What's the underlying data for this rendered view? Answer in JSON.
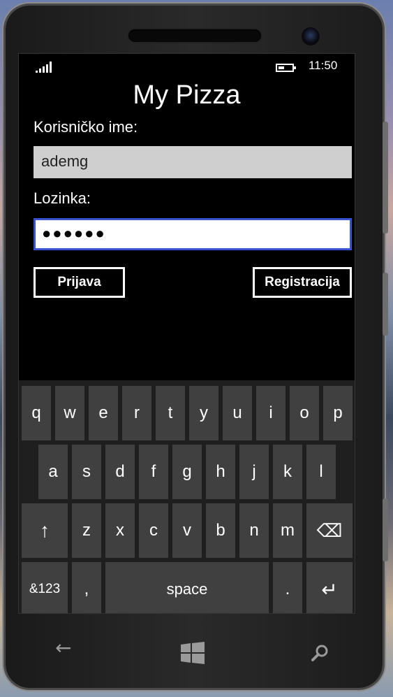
{
  "status_bar": {
    "time": "11:50",
    "icons": [
      "signal-icon",
      "battery-charging-icon"
    ]
  },
  "app": {
    "title": "My Pizza"
  },
  "form": {
    "username_label": "Korisničko ime:",
    "username_value": "ademg",
    "password_label": "Lozinka:",
    "password_value": "●●●●●●",
    "login_button": "Prijava",
    "register_button": "Registracija"
  },
  "keyboard": {
    "row1": [
      "q",
      "w",
      "e",
      "r",
      "t",
      "y",
      "u",
      "i",
      "o",
      "p"
    ],
    "row2": [
      "a",
      "s",
      "d",
      "f",
      "g",
      "h",
      "j",
      "k",
      "l"
    ],
    "row3_letters": [
      "z",
      "x",
      "c",
      "v",
      "b",
      "n",
      "m"
    ],
    "shift_icon": "↑",
    "backspace_icon": "⌫",
    "symbols_label": "&123",
    "comma_label": ",",
    "space_label": "space",
    "period_label": ".",
    "enter_icon": "↵"
  },
  "nav_bar": {
    "back_icon": "←",
    "search_icon": "search"
  },
  "colors": {
    "screen_bg": "#000000",
    "username_field_bg": "#cfcfcf",
    "password_border": "#3a53d2",
    "key_bg": "#404040",
    "keyboard_bg": "#1f1f1f"
  }
}
